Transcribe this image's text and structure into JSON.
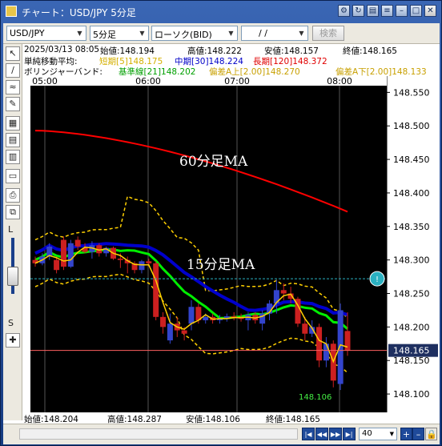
{
  "window": {
    "title": "チャート：USD/JPY 5分足",
    "buttons": [
      "⚙",
      "↻",
      "▤",
      "≡",
      "–",
      "□",
      "✕"
    ]
  },
  "toolbar": {
    "pair": "USD/JPY",
    "timeframe": "5分足",
    "chart_type": "ローソク(BID)",
    "date_value": "/ /",
    "search_label": "検索"
  },
  "left_tools": {
    "icons": [
      "↖",
      "∕",
      "≈",
      "✎",
      "▦",
      "▤",
      "▥",
      "▭",
      "⎙",
      "⧉"
    ],
    "L_label": "L",
    "S_label": "S",
    "plus": "✚"
  },
  "info": {
    "datetime": "2025/03/13 08:05",
    "open": "始値:148.194",
    "high": "高値:148.222",
    "low": "安値:148.157",
    "close": "終値:148.165"
  },
  "ma_bar": {
    "label": "単純移動平均:",
    "short": "短期[5]148.175",
    "mid": "中期[30]148.224",
    "long": "長期[120]148.372"
  },
  "bb_bar": {
    "label": "ボリンジャーバンド:",
    "base": "基準線[21]148.202",
    "upper": "偏差A上[2.00]148.270",
    "lower": "偏差A下[2.00]148.133"
  },
  "bottom": {
    "open": "始値:148.204",
    "high": "高値:148.287",
    "low": "安値:148.106",
    "close": "終値:148.165"
  },
  "status": {
    "zoom": "40"
  },
  "colors": {
    "bg": "#000000",
    "up": "#3344cc",
    "down": "#cc2020",
    "ma_short": "#ffd000",
    "ma_mid": "#0000cc",
    "ma_long": "#ff0000",
    "bb_base": "#00ee00",
    "bb_band": "#ffd000",
    "price_line": "#ff6060",
    "alert": "#2ab0c0"
  },
  "chart_data": {
    "type": "candlestick",
    "x_ticks": [
      "05:00",
      "06:00",
      "07:00",
      "08:00"
    ],
    "y_ticks": [
      "148.550",
      "148.500",
      "148.450",
      "148.400",
      "148.350",
      "148.300",
      "148.250",
      "148.200",
      "148.150",
      "148.100"
    ],
    "ylim": [
      148.075,
      148.56
    ],
    "current_price": "148.165",
    "alert_level": 148.272,
    "low_annotation": "148.106",
    "annotations": [
      "60分足MA",
      "15分足MA"
    ],
    "candles": [
      {
        "o": 148.3,
        "h": 148.305,
        "l": 148.29,
        "c": 148.295
      },
      {
        "o": 148.295,
        "h": 148.31,
        "l": 148.292,
        "c": 148.305
      },
      {
        "o": 148.305,
        "h": 148.325,
        "l": 148.3,
        "c": 148.32
      },
      {
        "o": 148.3,
        "h": 148.305,
        "l": 148.28,
        "c": 148.285
      },
      {
        "o": 148.33,
        "h": 148.335,
        "l": 148.285,
        "c": 148.29
      },
      {
        "o": 148.29,
        "h": 148.33,
        "l": 148.288,
        "c": 148.325
      },
      {
        "o": 148.33,
        "h": 148.335,
        "l": 148.315,
        "c": 148.32
      },
      {
        "o": 148.318,
        "h": 148.325,
        "l": 148.31,
        "c": 148.312
      },
      {
        "o": 148.312,
        "h": 148.328,
        "l": 148.302,
        "c": 148.322
      },
      {
        "o": 148.322,
        "h": 148.325,
        "l": 148.305,
        "c": 148.31
      },
      {
        "o": 148.31,
        "h": 148.32,
        "l": 148.305,
        "c": 148.318
      },
      {
        "o": 148.318,
        "h": 148.32,
        "l": 148.3,
        "c": 148.302
      },
      {
        "o": 148.302,
        "h": 148.31,
        "l": 148.288,
        "c": 148.3
      },
      {
        "o": 148.3,
        "h": 148.305,
        "l": 148.28,
        "c": 148.295
      },
      {
        "o": 148.295,
        "h": 148.298,
        "l": 148.28,
        "c": 148.285
      },
      {
        "o": 148.285,
        "h": 148.3,
        "l": 148.28,
        "c": 148.298
      },
      {
        "o": 148.298,
        "h": 148.302,
        "l": 148.29,
        "c": 148.295
      },
      {
        "o": 148.295,
        "h": 148.298,
        "l": 148.21,
        "c": 148.215
      },
      {
        "o": 148.215,
        "h": 148.222,
        "l": 148.19,
        "c": 148.2
      },
      {
        "o": 148.18,
        "h": 148.22,
        "l": 148.175,
        "c": 148.205
      },
      {
        "o": 148.205,
        "h": 148.215,
        "l": 148.185,
        "c": 148.195
      },
      {
        "o": 148.195,
        "h": 148.2,
        "l": 148.18,
        "c": 148.19
      },
      {
        "o": 148.205,
        "h": 148.24,
        "l": 148.195,
        "c": 148.23
      },
      {
        "o": 148.23,
        "h": 148.235,
        "l": 148.205,
        "c": 148.21
      },
      {
        "o": 148.21,
        "h": 148.22,
        "l": 148.205,
        "c": 148.215
      },
      {
        "o": 148.215,
        "h": 148.22,
        "l": 148.205,
        "c": 148.21
      },
      {
        "o": 148.21,
        "h": 148.218,
        "l": 148.205,
        "c": 148.212
      },
      {
        "o": 148.212,
        "h": 148.22,
        "l": 148.208,
        "c": 148.216
      },
      {
        "o": 148.216,
        "h": 148.222,
        "l": 148.21,
        "c": 148.214
      },
      {
        "o": 148.214,
        "h": 148.22,
        "l": 148.208,
        "c": 148.212
      },
      {
        "o": 148.21,
        "h": 148.222,
        "l": 148.195,
        "c": 148.218
      },
      {
        "o": 148.218,
        "h": 148.222,
        "l": 148.205,
        "c": 148.21
      },
      {
        "o": 148.205,
        "h": 148.225,
        "l": 148.195,
        "c": 148.22
      },
      {
        "o": 148.22,
        "h": 148.24,
        "l": 148.21,
        "c": 148.235
      },
      {
        "o": 148.235,
        "h": 148.27,
        "l": 148.22,
        "c": 148.255
      },
      {
        "o": 148.255,
        "h": 148.265,
        "l": 148.24,
        "c": 148.25
      },
      {
        "o": 148.25,
        "h": 148.26,
        "l": 148.235,
        "c": 148.242
      },
      {
        "o": 148.242,
        "h": 148.245,
        "l": 148.2,
        "c": 148.205
      },
      {
        "o": 148.205,
        "h": 148.215,
        "l": 148.18,
        "c": 148.19
      },
      {
        "o": 148.19,
        "h": 148.21,
        "l": 148.185,
        "c": 148.2
      },
      {
        "o": 148.2,
        "h": 148.205,
        "l": 148.14,
        "c": 148.15
      },
      {
        "o": 148.15,
        "h": 148.185,
        "l": 148.14,
        "c": 148.175
      },
      {
        "o": 148.175,
        "h": 148.18,
        "l": 148.11,
        "c": 148.12
      },
      {
        "o": 148.115,
        "h": 148.235,
        "l": 148.106,
        "c": 148.225
      },
      {
        "o": 148.194,
        "h": 148.222,
        "l": 148.157,
        "c": 148.165
      }
    ]
  }
}
